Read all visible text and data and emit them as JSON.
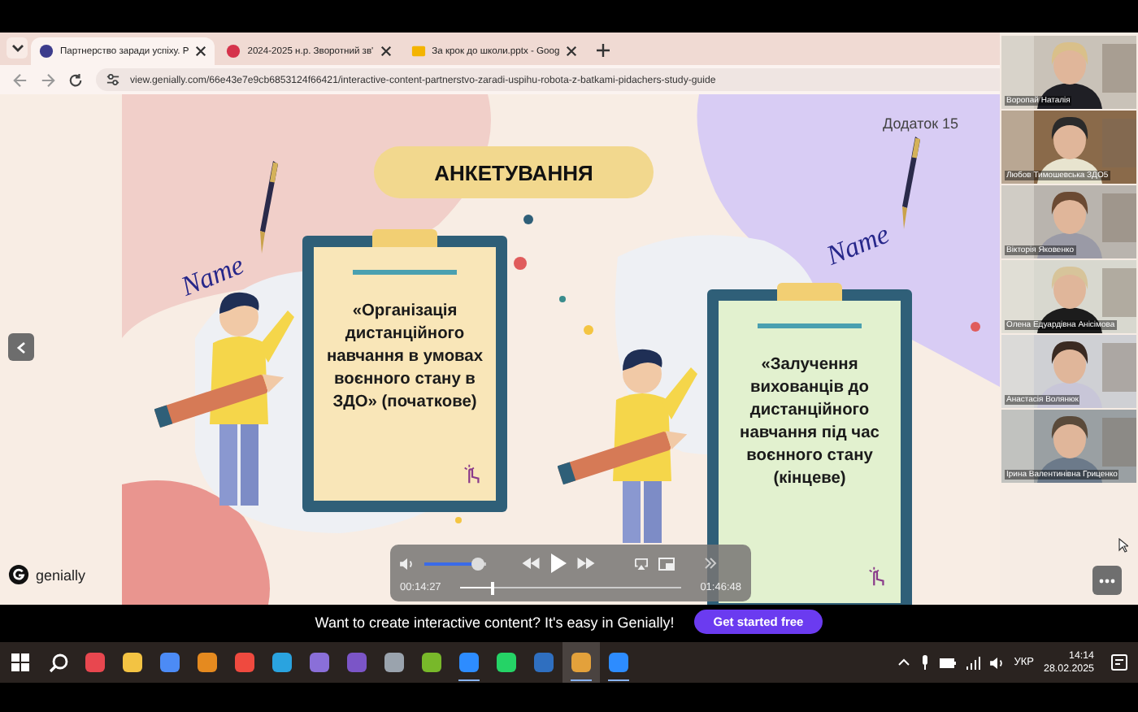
{
  "browser": {
    "tabs": [
      {
        "title": "Партнерство заради успіху. Р",
        "kind": "site",
        "selected": true
      },
      {
        "title": "2024-2025 н.р. Зворотний зв'",
        "kind": "form",
        "selected": false
      },
      {
        "title": "За крок до школи.pptx - Goog",
        "kind": "slides",
        "selected": false
      }
    ],
    "url": "view.genially.com/66e43e7e9cb6853124f66421/interactive-content-partnerstvo-zaradi-uspihu-robota-z-batkami-pidachers-study-guide"
  },
  "slide": {
    "title": "АНКЕТУВАННЯ",
    "appendix": "Додаток 15",
    "signatures": [
      "Name",
      "Name"
    ],
    "cards": [
      {
        "text": "«Організація дистанційного навчання в умовах воєнного стану в ЗДО» (початкове)",
        "color": "#f9e6b8"
      },
      {
        "text": "«Залучення вихованців до дистанційного навчання під час воєнного стану (кінцеве)",
        "color": "#e2f1cf"
      }
    ]
  },
  "brand": "genially",
  "player": {
    "volume": {
      "level": 0.88
    },
    "elapsed": "00:14:27",
    "progress": {
      "level": 0.14
    },
    "duration": "01:46:48"
  },
  "banner": {
    "text": "Want to create interactive content? It's easy in Genially!",
    "button": "Get started free"
  },
  "participants": [
    {
      "name": "Воропай Наталія"
    },
    {
      "name": "Любов Тимошевська ЗДО5"
    },
    {
      "name": "Вікторія Яковенко"
    },
    {
      "name": "Олена Едуардівна Анісімова"
    },
    {
      "name": "Анастасія Волянюк"
    },
    {
      "name": "Ірина Валентинівна Гриценко"
    }
  ],
  "taskbar": {
    "items": [
      {
        "kind": "start"
      },
      {
        "kind": "search"
      },
      {
        "kind": "app",
        "color": "#e8474f",
        "running": false,
        "selected": false
      },
      {
        "kind": "app",
        "color": "#f3c343",
        "running": false,
        "selected": false
      },
      {
        "kind": "app",
        "color": "#4c8bf5",
        "running": false,
        "selected": false
      },
      {
        "kind": "app",
        "color": "#e58a1f",
        "running": false,
        "selected": false
      },
      {
        "kind": "app",
        "color": "#ef4a3f",
        "running": false,
        "selected": false
      },
      {
        "kind": "app",
        "color": "#2aa3df",
        "running": false,
        "selected": false
      },
      {
        "kind": "app",
        "color": "#8a6fd8",
        "running": false,
        "selected": false
      },
      {
        "kind": "app",
        "color": "#7b55c7",
        "running": false,
        "selected": false
      },
      {
        "kind": "app",
        "color": "#9aa3ad",
        "running": false,
        "selected": false
      },
      {
        "kind": "app",
        "color": "#78b82a",
        "running": false,
        "selected": false
      },
      {
        "kind": "app",
        "color": "#2d8cff",
        "running": true,
        "selected": false
      },
      {
        "kind": "app",
        "color": "#25d366",
        "running": false,
        "selected": false
      },
      {
        "kind": "app",
        "color": "#2f6fc0",
        "running": false,
        "selected": false
      },
      {
        "kind": "app",
        "color": "#e3a13b",
        "running": true,
        "selected": true
      },
      {
        "kind": "app",
        "color": "#2d8cff",
        "running": true,
        "selected": false
      }
    ],
    "language": "УКР",
    "time": "14:14",
    "date": "28.02.2025"
  }
}
